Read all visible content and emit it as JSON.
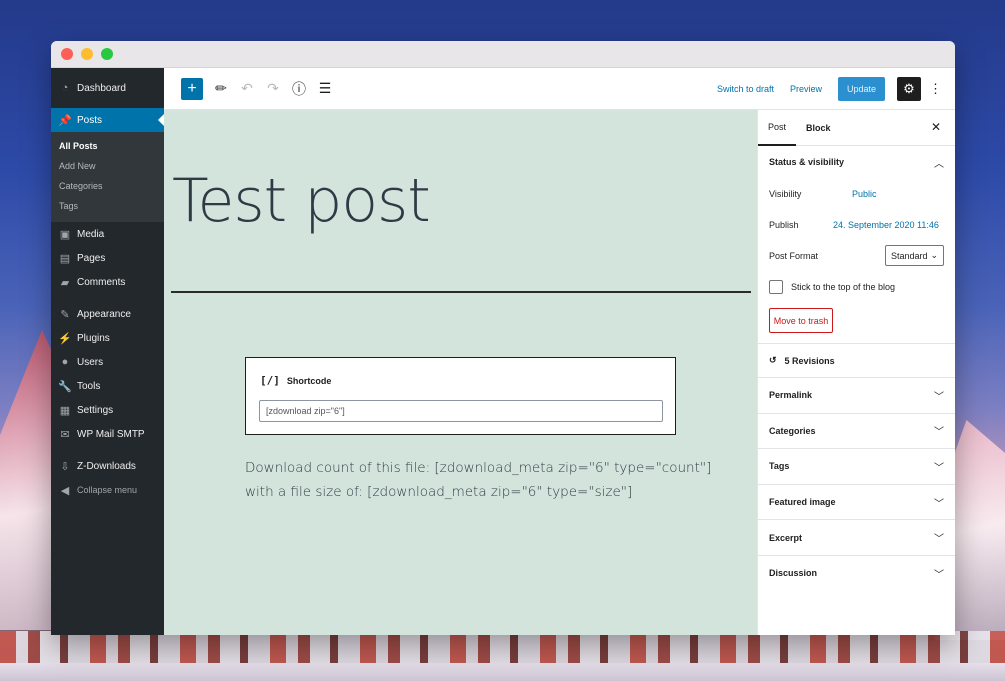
{
  "window": {
    "controls": [
      "close",
      "minimize",
      "zoom"
    ]
  },
  "sidebar": {
    "items": [
      {
        "label": "Dashboard",
        "icon": "dashboard-icon"
      },
      {
        "label": "Posts",
        "icon": "pin-icon"
      },
      {
        "label": "Media",
        "icon": "media-icon"
      },
      {
        "label": "Pages",
        "icon": "pages-icon"
      },
      {
        "label": "Comments",
        "icon": "comment-icon"
      },
      {
        "label": "Appearance",
        "icon": "brush-icon"
      },
      {
        "label": "Plugins",
        "icon": "plug-icon"
      },
      {
        "label": "Users",
        "icon": "user-icon"
      },
      {
        "label": "Tools",
        "icon": "wrench-icon"
      },
      {
        "label": "Settings",
        "icon": "settings-icon"
      },
      {
        "label": "WP Mail SMTP",
        "icon": "mail-icon"
      },
      {
        "label": "Z-Downloads",
        "icon": "download-icon"
      },
      {
        "label": "Collapse menu",
        "icon": "collapse-icon"
      }
    ],
    "posts_submenu": [
      "All Posts",
      "Add New",
      "Categories",
      "Tags"
    ]
  },
  "toolbar": {
    "add_label": "+",
    "switch_to_draft": "Switch to draft",
    "preview": "Preview",
    "update": "Update"
  },
  "editor": {
    "post_title": "Test post",
    "shortcode_icon": "[/]",
    "shortcode_label": "Shortcode",
    "shortcode_value": "[zdownload zip=\"6\"]",
    "paragraph_line1": "Download count of this file: [zdownload_meta zip=\"6\" type=\"count\"]",
    "paragraph_line2": "with a file size of: [zdownload_meta zip=\"6\" type=\"size\"]"
  },
  "panel": {
    "tabs": [
      "Post",
      "Block"
    ],
    "status_visibility": "Status & visibility",
    "visibility_label": "Visibility",
    "visibility_value": "Public",
    "publish_label": "Publish",
    "publish_value": "24. September 2020 11:46",
    "post_format_label": "Post Format",
    "post_format_value": "Standard",
    "sticky_label": "Stick to the top of the blog",
    "trash_label": "Move to trash",
    "revisions": "5 Revisions",
    "sections": [
      "Permalink",
      "Categories",
      "Tags",
      "Featured image",
      "Excerpt",
      "Discussion"
    ]
  },
  "colors": {
    "accent": "#0073aa",
    "admin_menu": "#23282d",
    "canvas_bg": "#d3e4dd",
    "danger": "#cc1818"
  }
}
